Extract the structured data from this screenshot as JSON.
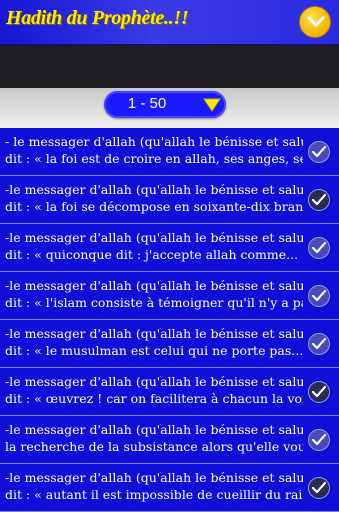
{
  "header": {
    "title": "Hadith du Prophète..!!"
  },
  "pager": {
    "range": "1 - 50"
  },
  "items": [
    {
      "line1": "- le messager d'allah (qu'allah le bénisse et salue) a",
      "line2": "dit : « la foi est de croire en allah, ses anges, ses...",
      "checked": false
    },
    {
      "line1": "-le messager d'allah (qu'allah le bénisse et salue) a",
      "line2": "dit : « la foi se décompose en soixante-dix branche...",
      "checked": true
    },
    {
      "line1": "-le messager d'allah (qu'allah le bénisse et salue) a",
      "line2": "dit : « quiconque dit : j'accepte allah comme...",
      "checked": false
    },
    {
      "line1": "-le messager d'allah (qu'allah le bénisse et salue) a",
      "line2": "dit : « l'islam consiste à témoigner qu'il n'y a pas ...",
      "checked": false
    },
    {
      "line1": "-le messager d'allah (qu'allah le bénisse et salue) a",
      "line2": "dit : « le musulman est celui qui ne porte pas...",
      "checked": false
    },
    {
      "line1": "-le messager d'allah (qu'allah le bénisse et salue) a",
      "line2": "dit : « œuvrez ! car on facilitera à chacun la voie...",
      "checked": true
    },
    {
      "line1": "-le messager d'allah (qu'allah le bénisse et salue) a",
      "line2": "la recherche de la subsistance alors qu'elle vous...",
      "checked": false
    },
    {
      "line1": "-le messager d'allah (qu'allah le bénisse et salue) a",
      "line2": "dit : « autant il est impossible de cueillir du raisin...",
      "checked": true
    }
  ]
}
